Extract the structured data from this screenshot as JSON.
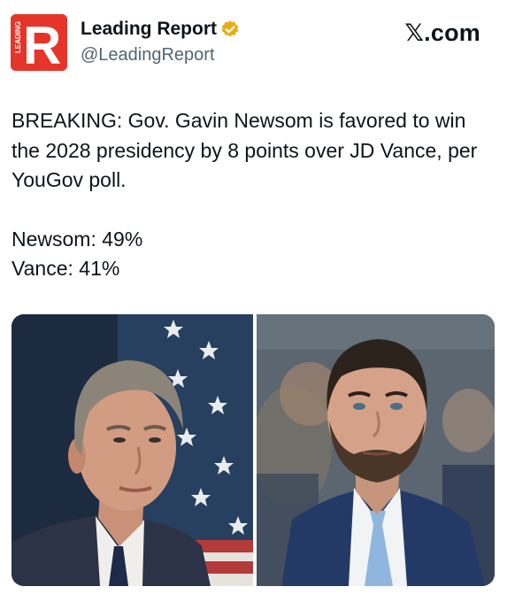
{
  "account": {
    "display_name": "Leading Report",
    "handle": "@LeadingReport",
    "logo_letter": "R",
    "logo_text": "LEADING",
    "verified_icon": "gold-verified-badge-icon",
    "brand_color": "#e5352b"
  },
  "platform": {
    "label": "𝕏.com"
  },
  "post": {
    "headline": "BREAKING: Gov. Gavin Newsom is favored to win the 2028 presidency by 8 points over JD Vance, per YouGov poll.",
    "results": [
      {
        "text": "Newsom: 49%"
      },
      {
        "text": "Vance: 41%"
      }
    ]
  },
  "media": {
    "left_photo": "photo of Gavin Newsom in front of an American flag",
    "right_photo": "photo of JD Vance in a suit with a light blue tie"
  }
}
